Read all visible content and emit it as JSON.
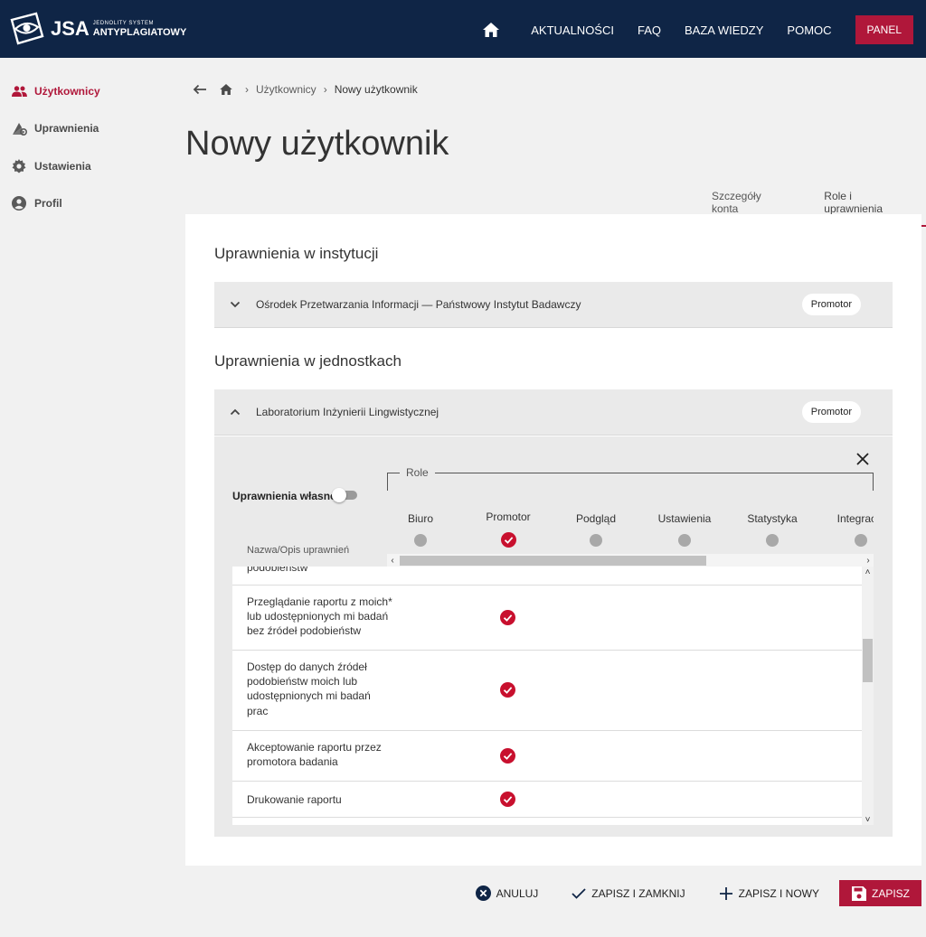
{
  "app": {
    "logo_short": "JSA",
    "logo_small": "JEDNOLITY SYSTEM",
    "logo_big": "ANTYPLAGIATOWY"
  },
  "nav": {
    "items": [
      "AKTUALNOŚCI",
      "FAQ",
      "BAZA WIEDZY",
      "POMOC"
    ],
    "panel_label": "PANEL"
  },
  "sidebar": {
    "items": [
      {
        "label": "Użytkownicy",
        "icon": "users-icon",
        "active": true
      },
      {
        "label": "Uprawnienia",
        "icon": "permissions-icon",
        "active": false
      },
      {
        "label": "Ustawienia",
        "icon": "gear-icon",
        "active": false
      },
      {
        "label": "Profil",
        "icon": "profile-icon",
        "active": false
      }
    ]
  },
  "breadcrumb": {
    "items": [
      "Użytkownicy",
      "Nowy użytkownik"
    ]
  },
  "page": {
    "title": "Nowy użytkownik"
  },
  "tabs": [
    {
      "label": "Szczegóły konta",
      "active": false
    },
    {
      "label": "Role i uprawnienia",
      "active": true
    }
  ],
  "institution": {
    "section_title": "Uprawnienia w instytucji",
    "name": "Ośrodek Przetwarzania Informacji — Państwowy Instytut Badawczy",
    "role_badge": "Promotor"
  },
  "units": {
    "section_title": "Uprawnienia w jednostkach",
    "name": "Laboratorium Inżynierii Lingwistycznej",
    "role_badge": "Promotor",
    "own_permissions_label": "Uprawnienia własne",
    "own_permissions_enabled": false,
    "roles_legend": "Role",
    "name_column_header": "Nazwa/Opis uprawnień",
    "roles": [
      {
        "name": "Biuro",
        "checked": false
      },
      {
        "name": "Promotor",
        "checked": true
      },
      {
        "name": "Podgląd",
        "checked": false
      },
      {
        "name": "Ustawienia",
        "checked": false
      },
      {
        "name": "Statystyka",
        "checked": false
      },
      {
        "name": "Integracja",
        "checked": false
      }
    ],
    "permissions": [
      {
        "label": "podobieństw",
        "checked": false
      },
      {
        "label": "Przeglądanie raportu z moich* lub udostępnionych mi badań bez źródeł podobieństw",
        "checked": true
      },
      {
        "label": "Dostęp do danych źródeł podobieństw moich lub udostępnionych mi badań prac",
        "checked": true
      },
      {
        "label": "Akceptowanie raportu przez promotora badania",
        "checked": true
      },
      {
        "label": "Drukowanie raportu",
        "checked": true
      }
    ]
  },
  "actions": {
    "cancel": "ANULUJ",
    "save_close": "ZAPISZ I ZAMKNIJ",
    "save_new": "ZAPISZ I NOWY",
    "save": "ZAPISZ"
  },
  "colors": {
    "navy": "#0f2546",
    "accent": "#b0173a",
    "inactive_dot": "#a8a8a8"
  }
}
